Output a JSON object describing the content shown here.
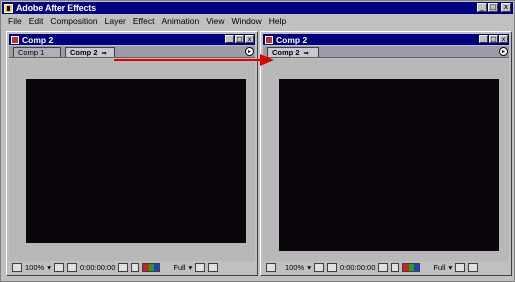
{
  "app": {
    "title": "Adobe After Effects",
    "menu": [
      "File",
      "Edit",
      "Composition",
      "Layer",
      "Effect",
      "Animation",
      "View",
      "Window",
      "Help"
    ],
    "window_buttons": [
      "_",
      "□",
      "x"
    ]
  },
  "left_window": {
    "title": "Comp 2",
    "tabs": [
      "Comp 1",
      "Comp 2"
    ],
    "tab_close_glyph": "⇒",
    "tab_menu_glyph": "▸",
    "zoom": "100%",
    "timecode": "0:00:00:00",
    "resolution": "Full"
  },
  "right_window": {
    "title": "Comp 2",
    "tabs": [
      "Comp 2"
    ],
    "tab_close_glyph": "⇒",
    "tab_menu_glyph": "▸",
    "zoom": "100%",
    "timecode": "0:00:00:00",
    "resolution": "Full"
  },
  "colors": {
    "titlebar": "#000080",
    "canvas": "#0a050a",
    "arrow": "#e00000"
  },
  "icons": {
    "swatch_colors": [
      "#d02020",
      "#20a020",
      "#2040d0",
      "#c0c0c0"
    ]
  }
}
